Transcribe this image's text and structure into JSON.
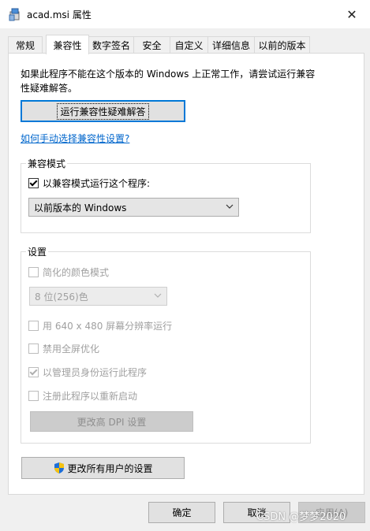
{
  "window": {
    "title": "acad.msi 属性",
    "close_glyph": "✕"
  },
  "tabs": [
    {
      "label": "常规"
    },
    {
      "label": "兼容性"
    },
    {
      "label": "数字签名"
    },
    {
      "label": "安全"
    },
    {
      "label": "自定义"
    },
    {
      "label": "详细信息"
    },
    {
      "label": "以前的版本"
    }
  ],
  "active_tab": "兼容性",
  "compat": {
    "intro_text": "如果此程序不能在这个版本的 Windows 上正常工作，请尝试运行兼容性疑难解答。",
    "troubleshoot_label": "运行兼容性疑难解答",
    "manual_link": "如何手动选择兼容性设置?",
    "mode_group_label": "兼容模式",
    "mode_checkbox_label": "以兼容模式运行这个程序:",
    "mode_checked": true,
    "mode_select_value": "以前版本的 Windows"
  },
  "settings": {
    "group_label": "设置",
    "reduced_color_label": "简化的颜色模式",
    "reduced_color_checked": false,
    "color_select_value": "8 位(256)色",
    "res_640_label": "用 640 x 480 屏幕分辨率运行",
    "res_640_checked": false,
    "disable_fullscreen_label": "禁用全屏优化",
    "disable_fullscreen_checked": false,
    "run_admin_label": "以管理员身份运行此程序",
    "run_admin_checked": true,
    "register_restart_label": "注册此程序以重新启动",
    "register_restart_checked": false,
    "dpi_button_label": "更改高 DPI 设置"
  },
  "all_users_button_label": "更改所有用户的设置",
  "footer": {
    "ok_label": "确定",
    "cancel_label": "取消",
    "apply_label": "应用(A)"
  },
  "watermark": "CSDN @梦梦2020",
  "colors": {
    "accent": "#0078d7",
    "link": "#0066cc",
    "disabled_text": "#a0a0a0",
    "shield_blue": "#1e6fd9",
    "shield_yellow": "#f5c211"
  },
  "icons": {
    "title": "msi-package-icon",
    "close": "close-icon",
    "dropdown": "chevron-down-icon",
    "uac": "uac-shield-icon"
  }
}
